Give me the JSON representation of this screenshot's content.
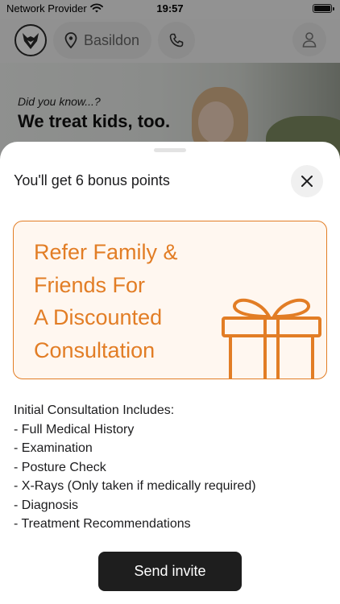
{
  "status_bar": {
    "carrier": "Network Provider",
    "time": "19:57"
  },
  "header": {
    "location": "Basildon",
    "icons": {
      "logo": "fox-logo-icon",
      "location": "map-pin-icon",
      "phone": "phone-icon",
      "profile": "user-icon"
    }
  },
  "banner": {
    "small_text": "Did you know...?",
    "big_text": "We treat kids, too."
  },
  "sheet": {
    "title": "You'll get 6 bonus points",
    "close_icon": "close-icon",
    "promo": {
      "lines": [
        "Refer Family &",
        "Friends For",
        "A Discounted",
        "Consultation"
      ],
      "icon": "gift-icon",
      "accent_color": "#e27d25",
      "background_color": "#fff7f0"
    },
    "includes": {
      "heading": "Initial Consultation Includes:",
      "items": [
        "- Full Medical History",
        "- Examination",
        "- Posture Check",
        "- X-Rays (Only taken if medically required)",
        "- Diagnosis",
        "- Treatment Recommendations"
      ]
    },
    "send_button": "Send invite"
  }
}
